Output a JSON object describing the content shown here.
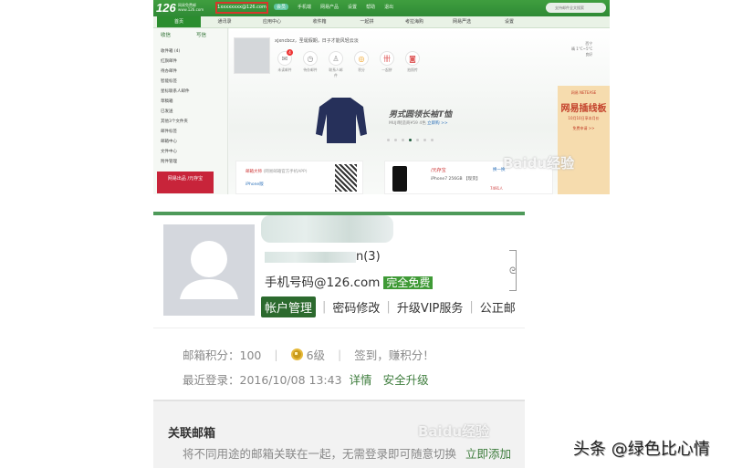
{
  "top_screenshot": {
    "logo": "126",
    "logo_sub": "网易免费邮 www.126.com",
    "account": "1xxxxxxxx@126.com",
    "vip_label": "会员",
    "header_links": [
      "手机端",
      "网易产品",
      "设置",
      "帮助",
      "退出"
    ],
    "search_placeholder": "支持邮件全文搜索",
    "nav_tabs": [
      "首页",
      "通讯录",
      "应用中心",
      "收件箱",
      "一起拼",
      "考拉海购",
      "网易严选",
      "设置"
    ],
    "receive": "收信",
    "compose": "写信",
    "folders": [
      "收件箱 (4)",
      "红旗邮件",
      "待办邮件",
      "智能标签",
      "星标联系人邮件",
      "草稿箱",
      "已发送",
      "其他3个文件夹",
      "邮件标签",
      "邮箱中心",
      "文件中心",
      "附件管理"
    ],
    "side_ad": "网易出品 /元存宝",
    "greeting": "xjxncbcz，圣诞假期，日子才能风轻云淡",
    "quick_icons": [
      "未读邮件",
      "待办邮件",
      "联系人邮件",
      "积分",
      "一起拼",
      "拍照传"
    ],
    "unread_badge": "4",
    "banner_title": "男式圆领长袖T恤",
    "banner_sub": "MUJI制造商¥59 4色",
    "banner_link": "立即购 >>",
    "weather": {
      "city": "西宁",
      "temp": "晴 1°C~5°C",
      "air": "良好"
    },
    "ad": {
      "brand": "网易 NETEASE",
      "title": "网易插线板",
      "sub": "10月10日享本月价",
      "cta": "免费申请 >>"
    },
    "master_title": "邮箱大师",
    "master_sub": "(网易邮箱官方手机APP)",
    "iphone": "iPhone版",
    "product": "iPhone7 256GB 【现货】",
    "product_brand": "/元存宝",
    "refresh": "换一换",
    "buyers": "7491人"
  },
  "account_panel": {
    "username_suffix": "n(3)",
    "email": "手机号码@126.com",
    "free_badge": "完全免费",
    "links": [
      "帐户管理",
      "密码修改",
      "升级VIP服务",
      "公正邮"
    ],
    "points_label": "邮箱积分：100",
    "level": "6级",
    "checkin": "签到，赚积分！",
    "last_login": "最近登录：2016/10/08 13:43",
    "details": "详情",
    "security": "安全升级",
    "linked_title": "关联邮箱",
    "linked_desc": "将不同用途的邮箱关联在一起，无需登录即可随意切换",
    "linked_add": "立即添加"
  },
  "watermark": "Baidu经验",
  "credit": "头条 @绿色比心情",
  "colors": {
    "brand_green": "#2b8d2f",
    "accent": "#3f9a36"
  }
}
